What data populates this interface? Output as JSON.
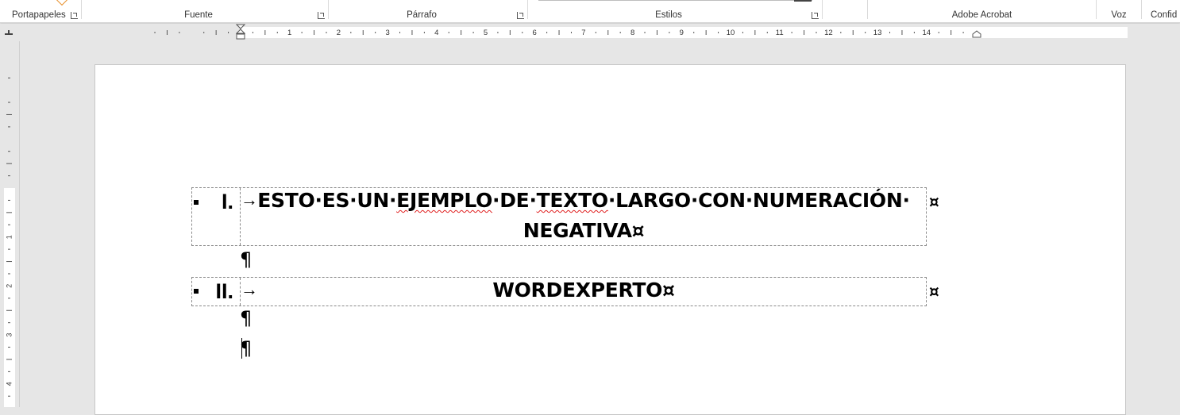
{
  "ribbon": {
    "groups": {
      "portapapeles": "Portapapeles",
      "fuente": "Fuente",
      "parrafo": "Párrafo",
      "estilos": "Estilos",
      "acrobat": "Adobe Acrobat",
      "voz": "Voz",
      "confidencialidad": "Confid"
    }
  },
  "ruler": {
    "numbers": [
      "1",
      "2",
      "3",
      "4",
      "5",
      "6",
      "7",
      "8",
      "9",
      "10",
      "11",
      "12",
      "13",
      "14"
    ],
    "vertical_numbers": [
      "1",
      "2",
      "3",
      "4"
    ]
  },
  "document": {
    "row1": {
      "numeral": "I.",
      "tab_glyph": "→",
      "line1_before": "ESTO·ES·UN·",
      "line1_err1": "EJEMPLO",
      "line1_mid": "·DE·",
      "line1_err2": "TEXTO",
      "line1_after": "·LARGO·CON·NUMERACIÓN·",
      "line2": "NEGATIVA¤",
      "end_of_row": "¤"
    },
    "row2": {
      "numeral": "II.",
      "tab_glyph": "→",
      "text": "WORDEXPERTO¤",
      "end_of_row": "¤"
    },
    "pilcrow": "¶"
  },
  "colors": {
    "spell_error": "#e02020",
    "accent_orange": "#e8912d"
  }
}
